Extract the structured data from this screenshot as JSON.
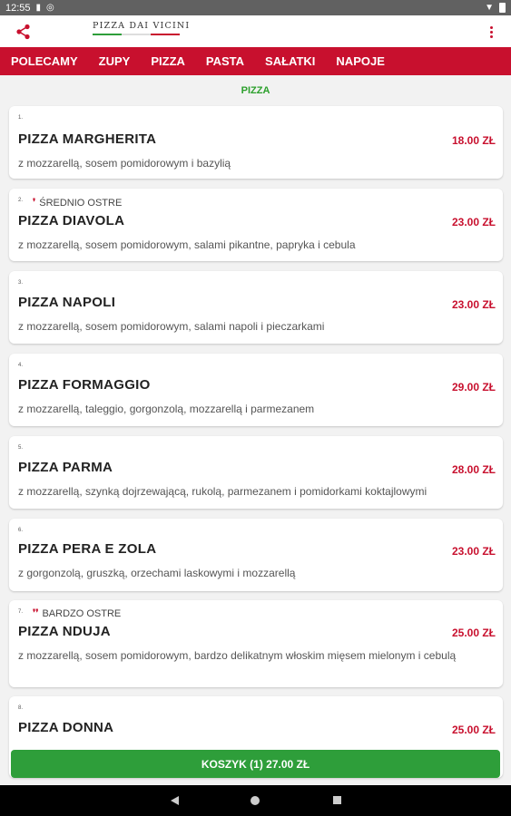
{
  "status": {
    "time": "12:55"
  },
  "header": {
    "logo_text": "PIZZA DAI VICINI",
    "colors": {
      "red": "#c8102e",
      "green": "#2e9e3a"
    }
  },
  "categories": [
    "POLECAMY",
    "ZUPY",
    "PIZZA",
    "PASTA",
    "SAŁATKI",
    "NAPOJE"
  ],
  "section_title": "PIZZA",
  "items": [
    {
      "number": "1.",
      "spice": "",
      "name": "PIZZA MARGHERITA",
      "price": "18.00 ZŁ",
      "description": "z mozzarellą, sosem pomidorowym i bazylią"
    },
    {
      "number": "2.",
      "spice": "ŚREDNIO OSTRE",
      "chili": "1",
      "name": "PIZZA DIAVOLA",
      "price": "23.00 ZŁ",
      "description": "z mozzarellą, sosem pomidorowym, salami pikantne, papryka i cebula"
    },
    {
      "number": "3.",
      "spice": "",
      "name": "PIZZA NAPOLI",
      "price": "23.00 ZŁ",
      "description": "z mozzarellą, sosem pomidorowym, salami napoli i pieczarkami"
    },
    {
      "number": "4.",
      "spice": "",
      "name": "PIZZA FORMAGGIO",
      "price": "29.00 ZŁ",
      "description": "z mozzarellą, taleggio, gorgonzolą, mozzarellą i parmezanem"
    },
    {
      "number": "5.",
      "spice": "",
      "name": "PIZZA PARMA",
      "price": "28.00 ZŁ",
      "description": "z mozzarellą, szynką dojrzewającą, rukolą, parmezanem i pomidorkami koktajlowymi"
    },
    {
      "number": "6.",
      "spice": "",
      "name": "PIZZA PERA E ZOLA",
      "price": "23.00 ZŁ",
      "description": "z gorgonzolą, gruszką, orzechami laskowymi i mozzarellą"
    },
    {
      "number": "7.",
      "spice": "BARDZO OSTRE",
      "chili": "2",
      "name": "PIZZA NDUJA",
      "price": "25.00 ZŁ",
      "description": "z mozzarellą, sosem pomidorowym, bardzo delikatnym włoskim mięsem mielonym i cebulą"
    },
    {
      "number": "8.",
      "spice": "",
      "name": "PIZZA DONNA",
      "price": "25.00 ZŁ",
      "description": ""
    }
  ],
  "cart": {
    "label": "KOSZYK  (1) 27.00 ZŁ"
  }
}
